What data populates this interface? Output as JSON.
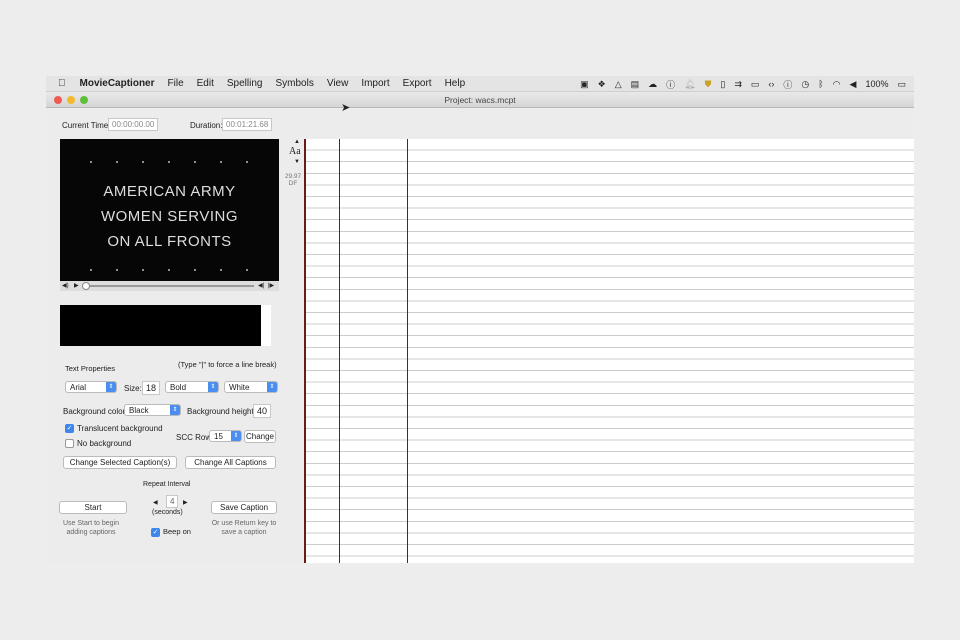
{
  "menubar": {
    "apple": "",
    "app": "MovieCaptioner",
    "items": [
      "File",
      "Edit",
      "Spelling",
      "Symbols",
      "View",
      "Import",
      "Export",
      "Help"
    ],
    "battery": "100%"
  },
  "window": {
    "title": "Project: wacs.mcpt"
  },
  "time": {
    "current_label": "Current Time:",
    "current_value": "00:00:00.00",
    "duration_label": "Duration:",
    "duration_value": "00:01:21.68"
  },
  "video": {
    "lines": [
      "AMERICAN ARMY",
      "WOMEN SERVING",
      "ON ALL FRONTS"
    ],
    "progress": 0
  },
  "fontsize_control": {
    "label": "Aa",
    "fps": "29.97",
    "mode": "DF"
  },
  "text_properties": {
    "title": "Text Properties",
    "hint": "(Type \"|\" to force a line break)",
    "font": "Arial",
    "size_label": "Size:",
    "size": "18",
    "weight": "Bold",
    "color": "White",
    "bg_color_label": "Background color",
    "bg_color": "Black",
    "bg_height_label": "Background height",
    "bg_height": "40",
    "translucent_label": "Translucent background",
    "translucent": true,
    "no_bg_label": "No background",
    "no_bg": false,
    "scc_label": "SCC Row:",
    "scc_row": "15",
    "change": "Change",
    "change_selected": "Change Selected Caption(s)",
    "change_all": "Change All Captions"
  },
  "capture": {
    "start": "Start",
    "start_note": "Use Start to begin adding captions",
    "repeat_label": "Repeat Interval",
    "repeat_value": "4",
    "seconds": "(seconds)",
    "beep_label": "Beep on",
    "beep": true,
    "save": "Save Caption",
    "save_note": "Or use Return key to save a caption"
  }
}
